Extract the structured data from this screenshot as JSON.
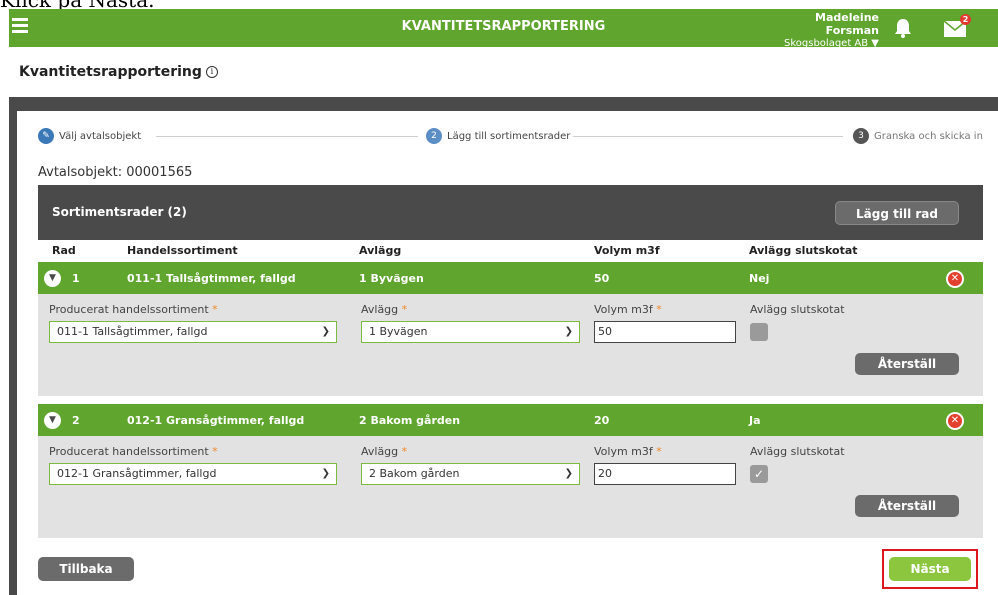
{
  "caption": "Klick på Nästa.",
  "app": {
    "title": "KVANTITETSRAPPORTERING",
    "user_name": "Madeleine Forsman",
    "company": "Skogsbolaget AB ▼",
    "mail_badge": "2",
    "accent_color": "#5fa52e",
    "icons": [
      "menu-icon",
      "bell-icon",
      "mail-icon"
    ]
  },
  "page": {
    "title": "Kvantitetsrapportering",
    "info_icon": "ⓘ"
  },
  "stepper": {
    "steps": [
      {
        "marker": "✎",
        "label": "Välj avtalsobjekt"
      },
      {
        "marker": "2",
        "label": "Lägg till sortimentsrader"
      },
      {
        "marker": "3",
        "label": "Granska och skicka in"
      }
    ]
  },
  "avtalsobjekt": "Avtalsobjekt: 00001565",
  "panel": {
    "title": "Sortimentsrader (2)",
    "add_button": "Lägg till rad"
  },
  "columns": [
    "Rad",
    "Handelssortiment",
    "Avlägg",
    "Volym m3f",
    "Avlägg slutskotat"
  ],
  "labels": {
    "producerat": "Producerat handelssortiment",
    "avlagg": "Avlägg",
    "volym": "Volym m3f",
    "slutskotat": "Avlägg slutskotat",
    "required_mark": "*",
    "reset_button": "Återställ"
  },
  "rows": [
    {
      "rad": "1",
      "sortiment": "011-1 Tallsågtimmer, fallgd",
      "avlagg": "1 Byvägen",
      "volym": "50",
      "slutskotat": "Nej",
      "select_sortiment": "011-1 Tallsågtimmer, fallgd",
      "select_avlagg": "1 Byvägen",
      "input_volym": "50",
      "checked": false
    },
    {
      "rad": "2",
      "sortiment": "012-1 Gransågtimmer, fallgd",
      "avlagg": "2 Bakom gården",
      "volym": "20",
      "slutskotat": "Ja",
      "select_sortiment": "012-1 Gransågtimmer, fallgd",
      "select_avlagg": "2 Bakom gården",
      "input_volym": "20",
      "checked": true
    }
  ],
  "footer": {
    "back_button": "Tillbaka",
    "next_button": "Nästa"
  }
}
